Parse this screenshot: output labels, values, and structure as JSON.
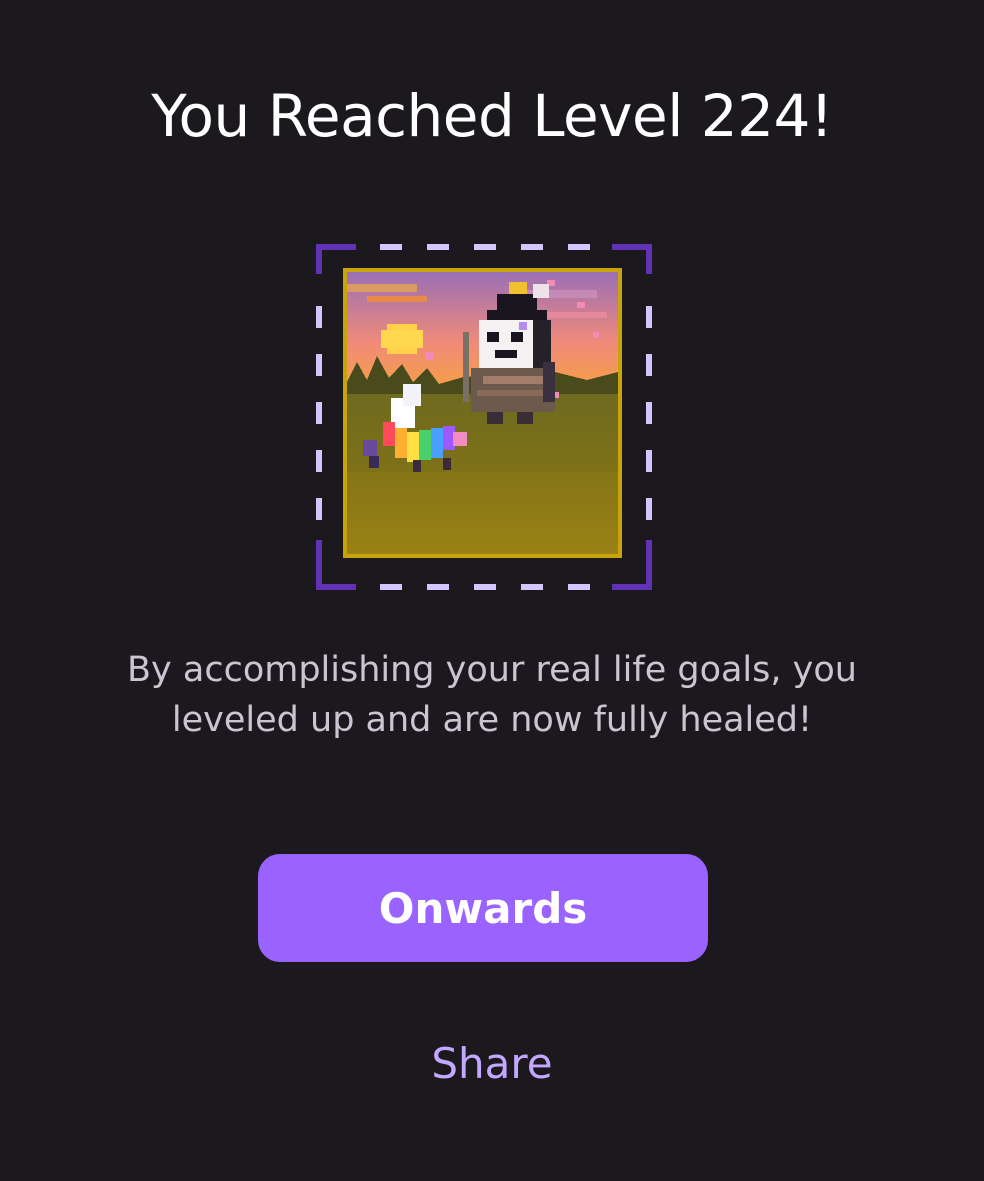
{
  "modal": {
    "title": "You Reached Level 224!",
    "message": "By accomplishing your real life goals, you leveled up and are now fully healed!",
    "primary_button_label": "Onwards",
    "secondary_link_label": "Share"
  },
  "colors": {
    "background": "#1b191e",
    "title_text": "#ffffff",
    "body_text": "#cac6d1",
    "primary_button": "#9a62ff",
    "link_text": "#c3a8ff",
    "frame_corner": "#6133b4",
    "frame_dash": "#d3c6ff",
    "scene_border": "#c9a30a"
  },
  "avatar": {
    "icon": "pixel-avatar-with-rainbow-pegasus-pet",
    "background": "sunset-meadow"
  }
}
